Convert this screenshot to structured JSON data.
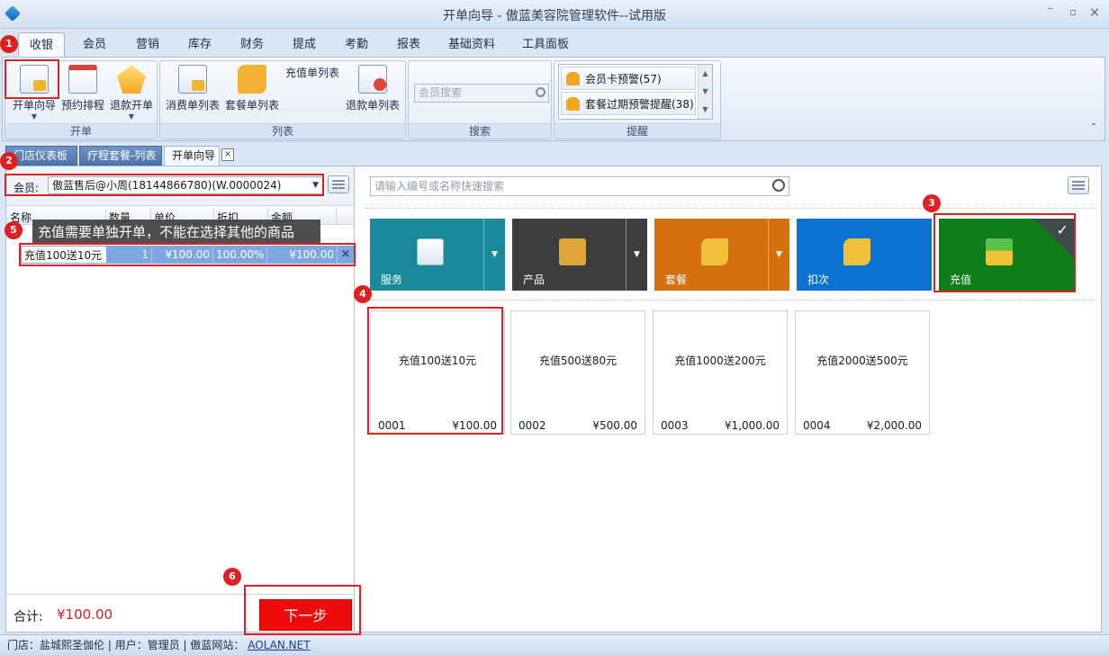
{
  "window": {
    "title": "开单向导 - 傲蓝美容院管理软件--试用版",
    "controls": [
      "‾",
      "▫",
      "×"
    ]
  },
  "ribbon_tabs": [
    "收银",
    "会员",
    "营销",
    "库存",
    "财务",
    "提成",
    "考勤",
    "报表",
    "基础资料",
    "工具面板"
  ],
  "ribbon": {
    "groups": [
      {
        "label": "开单",
        "buttons": [
          {
            "label": "开单向导",
            "icon": "sheet-icon"
          },
          {
            "label": "预约排程",
            "icon": "calendar-icon"
          },
          {
            "label": "退款开单",
            "icon": "refund-icon"
          }
        ]
      },
      {
        "label": "列表",
        "buttons": [
          {
            "label": "消费单列表",
            "icon": "receipt-list-icon"
          },
          {
            "label": "套餐单列表",
            "icon": "package-list-icon"
          },
          {
            "label": "充值单列表",
            "icon": "recharge-list-icon"
          },
          {
            "label": "退款单列表",
            "icon": "refund-list-icon"
          }
        ]
      },
      {
        "label": "搜索",
        "placeholder": "会员搜索"
      },
      {
        "label": "提醒",
        "alerts": [
          "会员卡预警(57)",
          "套餐过期预警提醒(38)"
        ]
      }
    ]
  },
  "doc_tabs": [
    "门店仪表板",
    "疗程套餐-列表",
    "开单向导"
  ],
  "left": {
    "member_label": "会员:",
    "member_value": "傲蓝售后@小周(18144866780)(W.0000024)",
    "columns": [
      "名称",
      "数量",
      "单价",
      "折扣",
      "金额"
    ],
    "row": {
      "name": "充值100送10元",
      "qty": "1",
      "price": "¥100.00",
      "discount": "100.00%",
      "amount": "¥100.00"
    },
    "tooltip": "充值需要单独开单，不能在选择其他的商品",
    "total_label": "合计:",
    "total_value": "¥100.00",
    "next_label": "下一步"
  },
  "right": {
    "search_placeholder": "请输入编号或名称快速搜索",
    "categories": [
      {
        "label": "服务",
        "color": "#1a8a9a"
      },
      {
        "label": "产品",
        "color": "#3d3d3d"
      },
      {
        "label": "套餐",
        "color": "#d5700e"
      },
      {
        "label": "扣次",
        "color": "#0c72cf"
      },
      {
        "label": "充值",
        "color": "#0e7e18"
      }
    ],
    "items": [
      {
        "name": "充值100送10元",
        "code": "0001",
        "price": "¥100.00"
      },
      {
        "name": "充值500送80元",
        "code": "0002",
        "price": "¥500.00"
      },
      {
        "name": "充值1000送200元",
        "code": "0003",
        "price": "¥1,000.00"
      },
      {
        "name": "充值2000送500元",
        "code": "0004",
        "price": "¥2,000.00"
      }
    ]
  },
  "status": {
    "store": "门店：盐城熙圣伽伦",
    "user": "用户：管理员",
    "site_label": "傲蓝网站：",
    "site_url": "AOLAN.NET"
  },
  "markers": [
    "1",
    "2",
    "3",
    "4",
    "5",
    "6"
  ]
}
